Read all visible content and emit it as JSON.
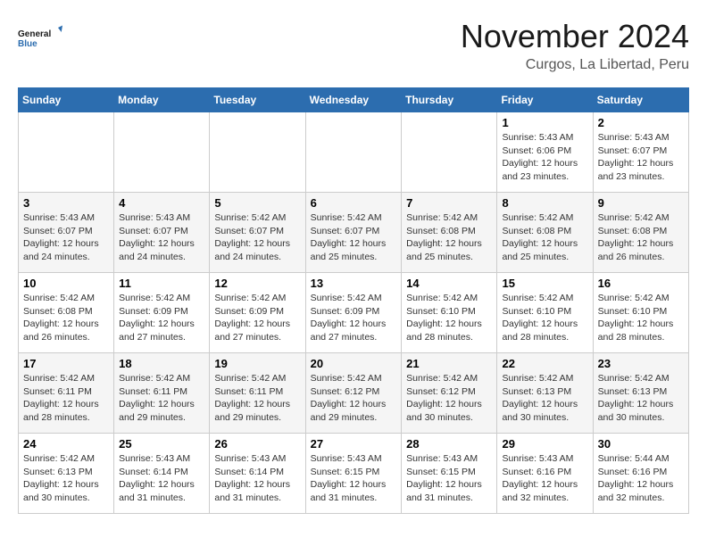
{
  "logo": {
    "text_general": "General",
    "text_blue": "Blue"
  },
  "title": "November 2024",
  "location": "Curgos, La Libertad, Peru",
  "weekdays": [
    "Sunday",
    "Monday",
    "Tuesday",
    "Wednesday",
    "Thursday",
    "Friday",
    "Saturday"
  ],
  "weeks": [
    [
      {
        "day": "",
        "info": ""
      },
      {
        "day": "",
        "info": ""
      },
      {
        "day": "",
        "info": ""
      },
      {
        "day": "",
        "info": ""
      },
      {
        "day": "",
        "info": ""
      },
      {
        "day": "1",
        "info": "Sunrise: 5:43 AM\nSunset: 6:06 PM\nDaylight: 12 hours and 23 minutes."
      },
      {
        "day": "2",
        "info": "Sunrise: 5:43 AM\nSunset: 6:07 PM\nDaylight: 12 hours and 23 minutes."
      }
    ],
    [
      {
        "day": "3",
        "info": "Sunrise: 5:43 AM\nSunset: 6:07 PM\nDaylight: 12 hours and 24 minutes."
      },
      {
        "day": "4",
        "info": "Sunrise: 5:43 AM\nSunset: 6:07 PM\nDaylight: 12 hours and 24 minutes."
      },
      {
        "day": "5",
        "info": "Sunrise: 5:42 AM\nSunset: 6:07 PM\nDaylight: 12 hours and 24 minutes."
      },
      {
        "day": "6",
        "info": "Sunrise: 5:42 AM\nSunset: 6:07 PM\nDaylight: 12 hours and 25 minutes."
      },
      {
        "day": "7",
        "info": "Sunrise: 5:42 AM\nSunset: 6:08 PM\nDaylight: 12 hours and 25 minutes."
      },
      {
        "day": "8",
        "info": "Sunrise: 5:42 AM\nSunset: 6:08 PM\nDaylight: 12 hours and 25 minutes."
      },
      {
        "day": "9",
        "info": "Sunrise: 5:42 AM\nSunset: 6:08 PM\nDaylight: 12 hours and 26 minutes."
      }
    ],
    [
      {
        "day": "10",
        "info": "Sunrise: 5:42 AM\nSunset: 6:08 PM\nDaylight: 12 hours and 26 minutes."
      },
      {
        "day": "11",
        "info": "Sunrise: 5:42 AM\nSunset: 6:09 PM\nDaylight: 12 hours and 27 minutes."
      },
      {
        "day": "12",
        "info": "Sunrise: 5:42 AM\nSunset: 6:09 PM\nDaylight: 12 hours and 27 minutes."
      },
      {
        "day": "13",
        "info": "Sunrise: 5:42 AM\nSunset: 6:09 PM\nDaylight: 12 hours and 27 minutes."
      },
      {
        "day": "14",
        "info": "Sunrise: 5:42 AM\nSunset: 6:10 PM\nDaylight: 12 hours and 28 minutes."
      },
      {
        "day": "15",
        "info": "Sunrise: 5:42 AM\nSunset: 6:10 PM\nDaylight: 12 hours and 28 minutes."
      },
      {
        "day": "16",
        "info": "Sunrise: 5:42 AM\nSunset: 6:10 PM\nDaylight: 12 hours and 28 minutes."
      }
    ],
    [
      {
        "day": "17",
        "info": "Sunrise: 5:42 AM\nSunset: 6:11 PM\nDaylight: 12 hours and 28 minutes."
      },
      {
        "day": "18",
        "info": "Sunrise: 5:42 AM\nSunset: 6:11 PM\nDaylight: 12 hours and 29 minutes."
      },
      {
        "day": "19",
        "info": "Sunrise: 5:42 AM\nSunset: 6:11 PM\nDaylight: 12 hours and 29 minutes."
      },
      {
        "day": "20",
        "info": "Sunrise: 5:42 AM\nSunset: 6:12 PM\nDaylight: 12 hours and 29 minutes."
      },
      {
        "day": "21",
        "info": "Sunrise: 5:42 AM\nSunset: 6:12 PM\nDaylight: 12 hours and 30 minutes."
      },
      {
        "day": "22",
        "info": "Sunrise: 5:42 AM\nSunset: 6:13 PM\nDaylight: 12 hours and 30 minutes."
      },
      {
        "day": "23",
        "info": "Sunrise: 5:42 AM\nSunset: 6:13 PM\nDaylight: 12 hours and 30 minutes."
      }
    ],
    [
      {
        "day": "24",
        "info": "Sunrise: 5:42 AM\nSunset: 6:13 PM\nDaylight: 12 hours and 30 minutes."
      },
      {
        "day": "25",
        "info": "Sunrise: 5:43 AM\nSunset: 6:14 PM\nDaylight: 12 hours and 31 minutes."
      },
      {
        "day": "26",
        "info": "Sunrise: 5:43 AM\nSunset: 6:14 PM\nDaylight: 12 hours and 31 minutes."
      },
      {
        "day": "27",
        "info": "Sunrise: 5:43 AM\nSunset: 6:15 PM\nDaylight: 12 hours and 31 minutes."
      },
      {
        "day": "28",
        "info": "Sunrise: 5:43 AM\nSunset: 6:15 PM\nDaylight: 12 hours and 31 minutes."
      },
      {
        "day": "29",
        "info": "Sunrise: 5:43 AM\nSunset: 6:16 PM\nDaylight: 12 hours and 32 minutes."
      },
      {
        "day": "30",
        "info": "Sunrise: 5:44 AM\nSunset: 6:16 PM\nDaylight: 12 hours and 32 minutes."
      }
    ]
  ]
}
